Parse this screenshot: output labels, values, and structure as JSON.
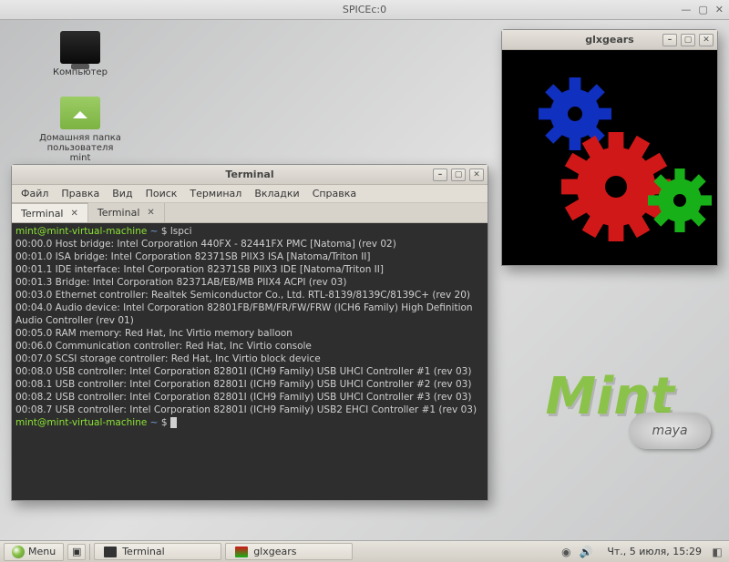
{
  "spice": {
    "title": "SPICEc:0"
  },
  "desktop_icons": {
    "computer": "Компьютер",
    "home_line1": "Домашняя папка",
    "home_line2": "пользователя mint"
  },
  "terminal_window": {
    "title": "Terminal",
    "menu": {
      "file": "Файл",
      "edit": "Правка",
      "view": "Вид",
      "search": "Поиск",
      "terminal": "Терминал",
      "tabs": "Вкладки",
      "help": "Справка"
    },
    "tabs": [
      {
        "label": "Terminal",
        "active": true
      },
      {
        "label": "Terminal",
        "active": false
      }
    ],
    "prompt_user": "mint@mint-virtual-machine",
    "prompt_tilde": "~",
    "prompt_sep": "$",
    "command": "lspci",
    "output": [
      "00:00.0 Host bridge: Intel Corporation 440FX - 82441FX PMC [Natoma] (rev 02)",
      "00:01.0 ISA bridge: Intel Corporation 82371SB PIIX3 ISA [Natoma/Triton II]",
      "00:01.1 IDE interface: Intel Corporation 82371SB PIIX3 IDE [Natoma/Triton II]",
      "00:01.3 Bridge: Intel Corporation 82371AB/EB/MB PIIX4 ACPI (rev 03)",
      "00:03.0 Ethernet controller: Realtek Semiconductor Co., Ltd. RTL-8139/8139C/8139C+ (rev 20)",
      "00:04.0 Audio device: Intel Corporation 82801FB/FBM/FR/FW/FRW (ICH6 Family) High Definition Audio Controller (rev 01)",
      "00:05.0 RAM memory: Red Hat, Inc Virtio memory balloon",
      "00:06.0 Communication controller: Red Hat, Inc Virtio console",
      "00:07.0 SCSI storage controller: Red Hat, Inc Virtio block device",
      "00:08.0 USB controller: Intel Corporation 82801I (ICH9 Family) USB UHCI Controller #1 (rev 03)",
      "00:08.1 USB controller: Intel Corporation 82801I (ICH9 Family) USB UHCI Controller #2 (rev 03)",
      "00:08.2 USB controller: Intel Corporation 82801I (ICH9 Family) USB UHCI Controller #3 (rev 03)",
      "00:08.7 USB controller: Intel Corporation 82801I (ICH9 Family) USB2 EHCI Controller #1 (rev 03)"
    ]
  },
  "glxgears_window": {
    "title": "glxgears"
  },
  "watermark": {
    "word": "Mint",
    "badge": "maya"
  },
  "taskbar": {
    "menu_label": "Menu",
    "tasks": [
      {
        "label": "Terminal"
      },
      {
        "label": "glxgears"
      }
    ],
    "clock": "Чт.,  5 июля, 15:29"
  }
}
